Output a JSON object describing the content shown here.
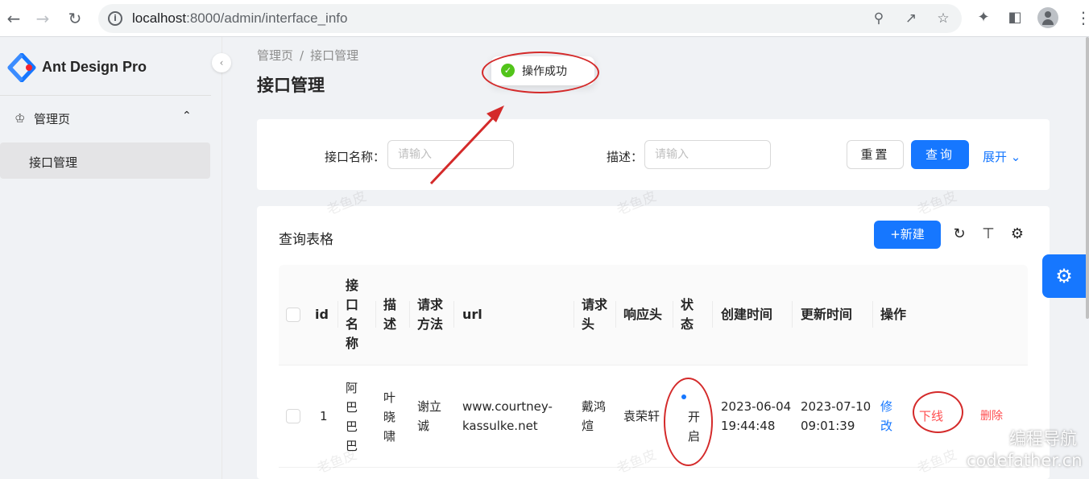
{
  "browser": {
    "url_host": "localhost",
    "url_path": ":8000/admin/interface_info"
  },
  "brand": "Ant Design Pro",
  "menu": {
    "group_label": "管理页",
    "items": [
      {
        "label": "接口管理"
      }
    ]
  },
  "breadcrumb": [
    "管理页",
    "接口管理"
  ],
  "page_title": "接口管理",
  "toast": "操作成功",
  "search": {
    "fields": [
      {
        "label": "接口名称：",
        "placeholder": "请输入"
      },
      {
        "label": "描述：",
        "placeholder": "请输入"
      }
    ],
    "reset_label": "重置",
    "query_label": "查询",
    "expand_label": "展开"
  },
  "table": {
    "title": "查询表格",
    "new_label": "新建",
    "columns": [
      "id",
      "接口名称",
      "描述",
      "请求方法",
      "url",
      "请求头",
      "响应头",
      "状态",
      "创建时间",
      "更新时间",
      "操作"
    ],
    "rows": [
      {
        "id": "1",
        "name": "阿巴巴巴",
        "description": "叶晓啸",
        "method": "谢立诚",
        "url": "www.courtney-kassulke.net",
        "request_header": "戴鸿煊",
        "response_header": "袁荣轩",
        "status": "开启",
        "created": "2023-06-04 19:44:48",
        "updated": "2023-07-10 09:01:39",
        "actions": [
          "修改",
          "下线",
          "删除"
        ]
      }
    ]
  },
  "watermark": "老鱼皮",
  "site_mark": [
    "编程导航",
    "codefather.cn"
  ],
  "colors": {
    "primary": "#1677ff",
    "danger": "#ff4d4f",
    "success": "#52c41a",
    "annotation": "#d42a2a"
  }
}
